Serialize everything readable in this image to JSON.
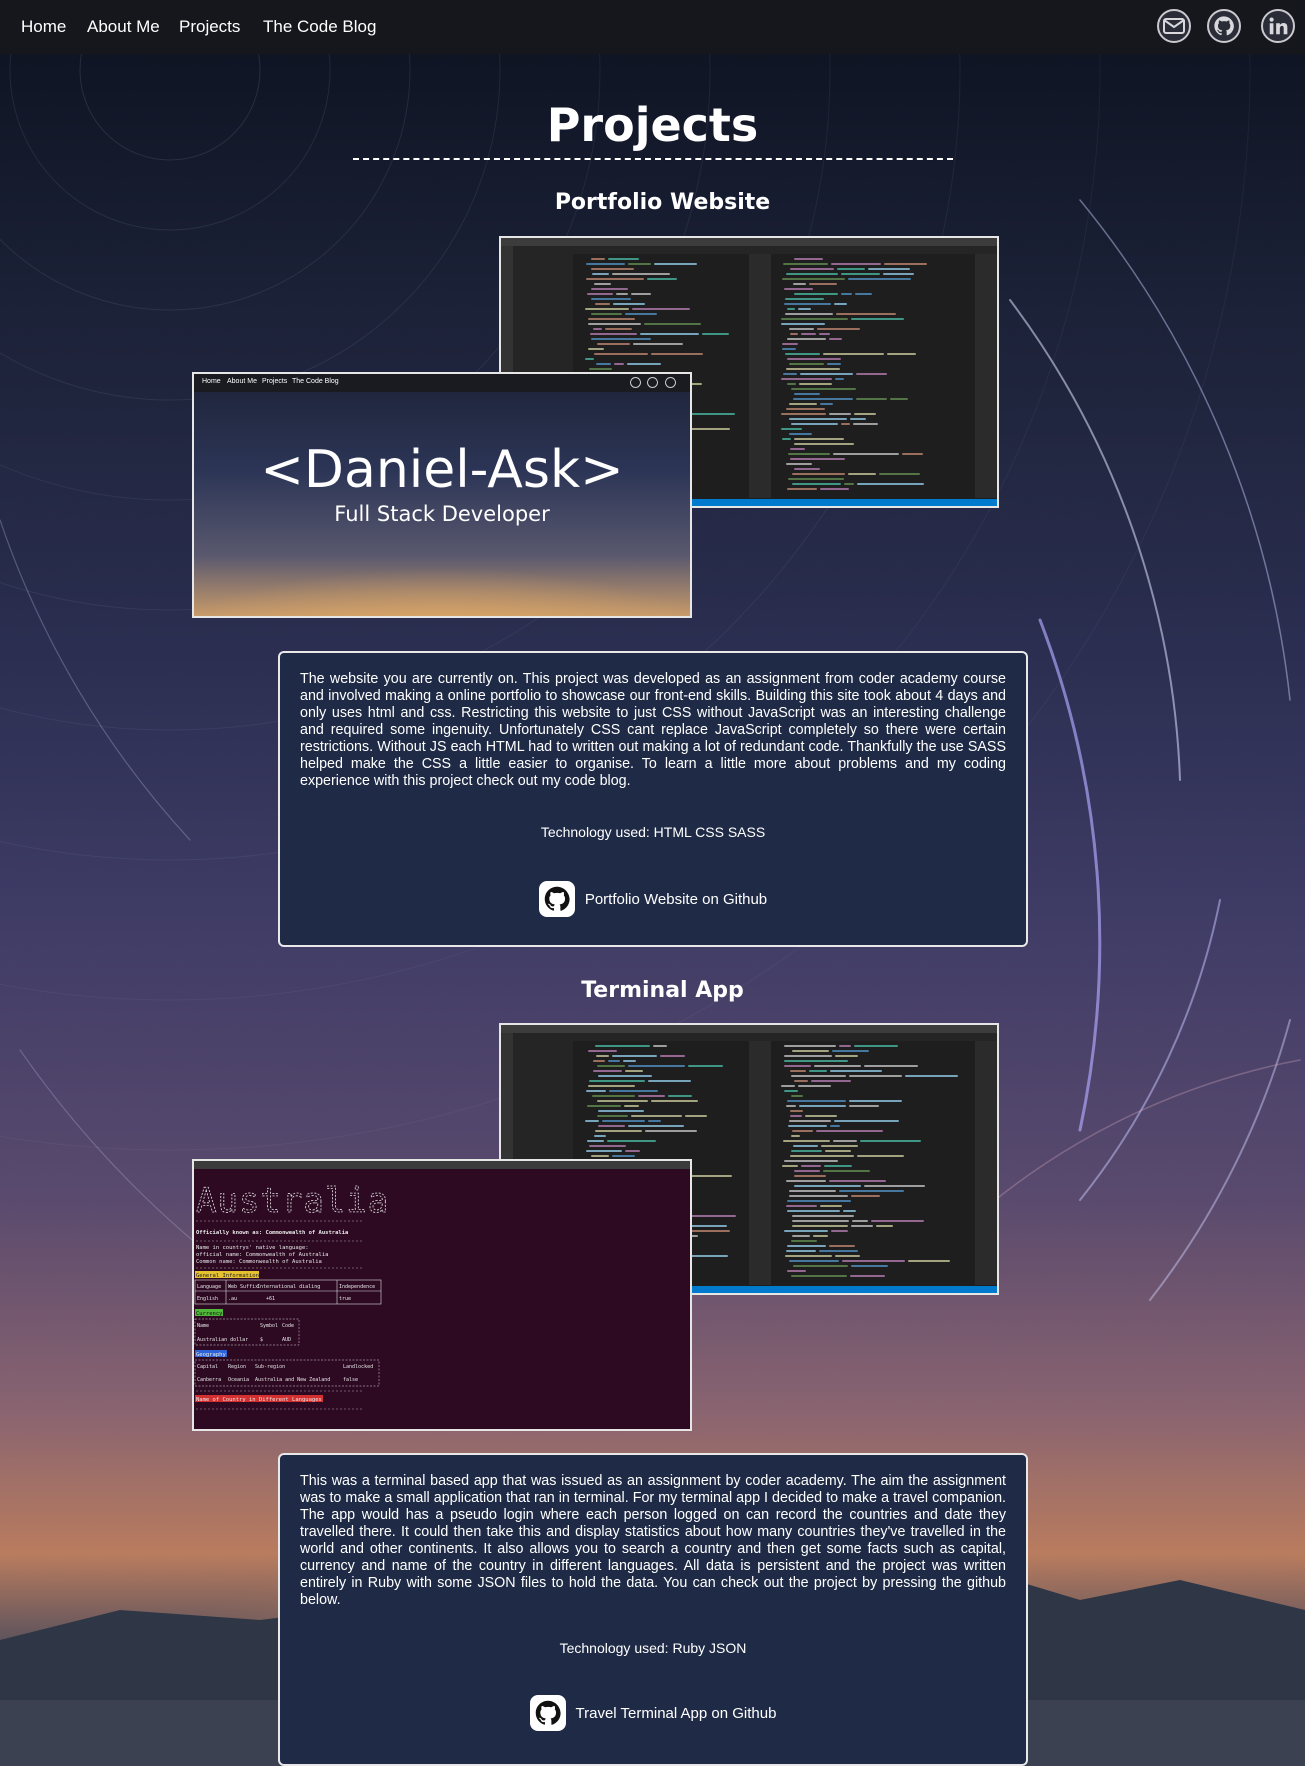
{
  "nav": {
    "links": [
      "Home",
      "About Me",
      "Projects",
      "The Code Blog"
    ],
    "social_icons": [
      "mail-icon",
      "github-icon",
      "linkedin-icon"
    ]
  },
  "page": {
    "title": "Projects"
  },
  "projects": [
    {
      "title": "Portfolio Website",
      "screenshot": {
        "site_nav": [
          "Home",
          "About Me",
          "Projects",
          "The Code Blog"
        ],
        "hero_name": "<Daniel-Ask>",
        "hero_subtitle": "Full Stack Developer"
      },
      "description": "The website you are currently on. This project was developed as an assignment from coder academy course and involved making a online portfolio to showcase our front-end skills. Building this site took about 4 days and only uses html and css. Restricting this website to just CSS without JavaScript was an interesting challenge and required some ingenuity. Unfortunately CSS cant replace JavaScript completely so there were certain restrictions. Without JS each HTML had to written out making a lot of redundant code. Thankfully the use SASS helped make the CSS a little easier to organise. To learn a little more about problems and my coding experience with this project check out my code blog.",
      "technology": "Technology used: HTML CSS SASS",
      "github_label": "Portfolio Website on Github"
    },
    {
      "title": "Terminal App",
      "screenshot": {
        "banner": "Australia",
        "lines": [
          "Officially known as: Commonwealth of Australia",
          "Name in countrys' native language:",
          "official name: Commonwealth of Australia",
          "Common name: Commonwealth of Australia"
        ],
        "section_general": "General Information",
        "general_headers": [
          "Language",
          "Web Suffix",
          "International dialing",
          "Independence"
        ],
        "general_row": [
          "English",
          ".au",
          "+61",
          "true"
        ],
        "section_currency": "Currency",
        "currency_headers": [
          "Name",
          "Symbol",
          "Code"
        ],
        "currency_row": [
          "Australian dollar",
          "$",
          "AUD"
        ],
        "section_geography": "Geography",
        "geography_headers": [
          "Capital",
          "Region",
          "Sub-region",
          "Landlocked"
        ],
        "geography_row": [
          "Canberra",
          "Oceania",
          "Australia and New Zealand",
          "false"
        ],
        "section_languages": "Name of Country in Different Languages"
      },
      "description": "This was a terminal based app that was issued as an assignment by coder academy. The aim the assignment was to make a small application that ran in terminal. For my terminal app I decided to make a travel companion. The app would has a pseudo login where each person logged on can record the countries and date they travelled there. It could then take this and display statistics about how many countries they've travelled in the world and other continents. It also allows you to search a country and then get some facts such as capital, currency and name of the country in different languages. All data is persistent and the project was written entirely in Ruby with some JSON files to hold the data. You can check out the project by pressing the github below.",
      "technology": "Technology used: Ruby JSON",
      "github_label": "Travel Terminal App on Github"
    }
  ],
  "colors": {
    "nav_bg": "#16171c",
    "card_bg": "#1f2b46",
    "card_border": "#e8e8e8",
    "editor_bg": "#1e1e1e",
    "editor_status": "#007acc",
    "terminal_bg": "#2d0a22"
  }
}
